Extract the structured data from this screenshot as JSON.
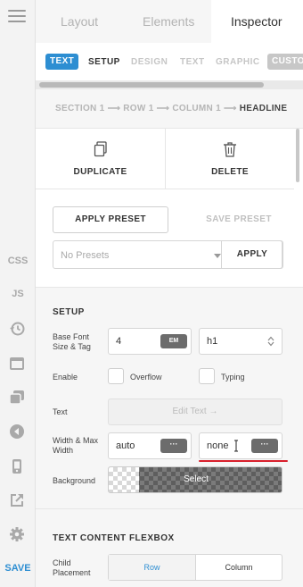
{
  "rail": {
    "css_label": "CSS",
    "js_label": "JS",
    "save_label": "SAVE",
    "icons": [
      "menu-icon",
      "history-icon",
      "layout-icon",
      "layers-icon",
      "back-icon",
      "mobile-icon",
      "external-link-icon",
      "gear-icon"
    ]
  },
  "tabs": {
    "layout": "Layout",
    "elements": "Elements",
    "inspector": "Inspector",
    "active": "Inspector"
  },
  "subtabs": {
    "text_pill": "TEXT",
    "setup": "SETUP",
    "design": "DESIGN",
    "text": "TEXT",
    "graphic": "GRAPHIC",
    "custom": "CUSTO"
  },
  "breadcrumb": {
    "path": "SECTION 1 ⟶ ROW 1 ⟶ COLUMN 1 ⟶",
    "current": "HEADLINE"
  },
  "actions": {
    "duplicate": "DUPLICATE",
    "delete": "DELETE"
  },
  "preset": {
    "apply_preset": "APPLY PRESET",
    "save_preset": "SAVE PRESET",
    "select_value": "No Presets",
    "apply": "APPLY"
  },
  "setup": {
    "title": "SETUP",
    "base_font_label": "Base Font Size & Tag",
    "font_size": "4",
    "font_unit": "EM",
    "tag": "h1",
    "enable_label": "Enable",
    "overflow": "Overflow",
    "typing": "Typing",
    "text_label": "Text",
    "edit_text": "Edit Text →",
    "width_label": "Width & Max Width",
    "width": "auto",
    "max_width": "none",
    "dots": "···",
    "background_label": "Background",
    "background_select": "Select"
  },
  "flexbox": {
    "title": "TEXT CONTENT FLEXBOX",
    "child_label": "Child Placement",
    "row": "Row",
    "column": "Column"
  },
  "colors": {
    "accent": "#2d8ed2",
    "annotation": "#d9202c"
  }
}
